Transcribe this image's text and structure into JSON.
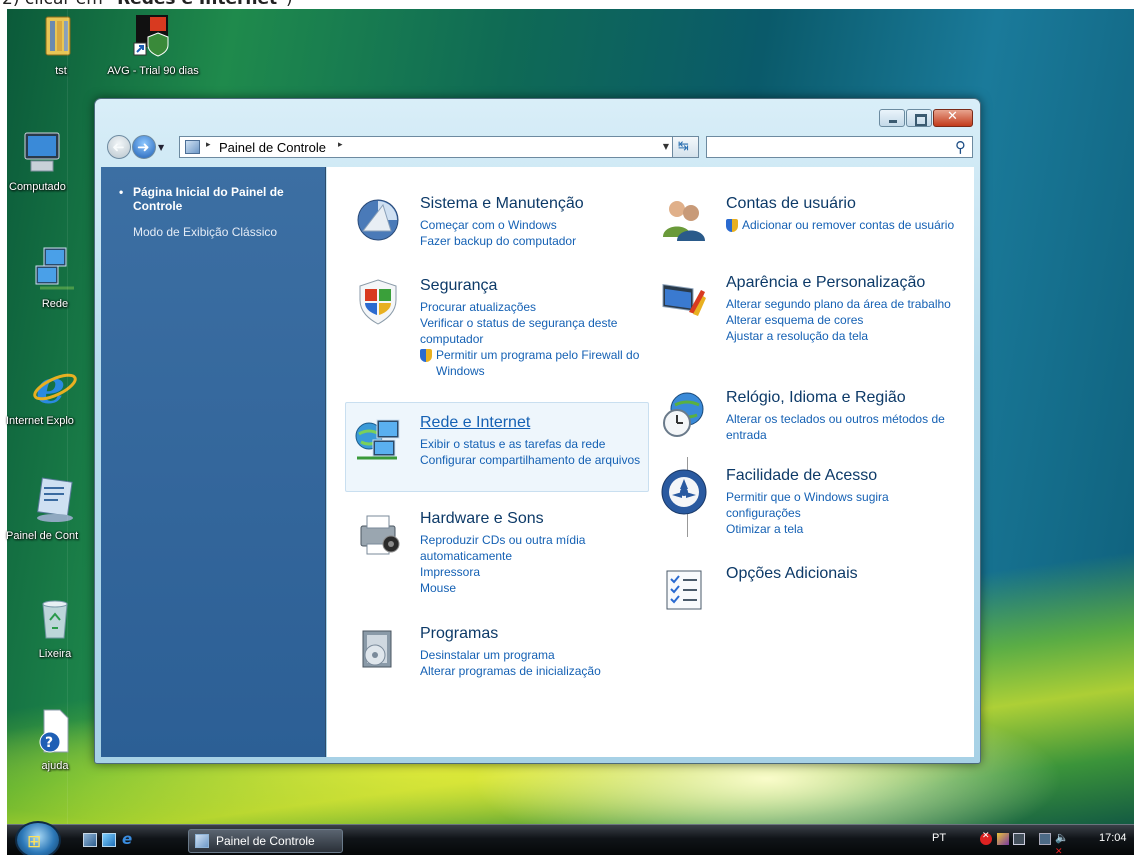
{
  "caption": {
    "prefix": "2) clicar em ",
    "bold": "\"Redes e Internet\"",
    "suffix": ")"
  },
  "desktop": {
    "icons": [
      {
        "label": "tst"
      },
      {
        "label": "AVG - Trial 90 dias"
      },
      {
        "label": "Computado"
      },
      {
        "label": "Rede"
      },
      {
        "label": "Internet Explo"
      },
      {
        "label": "Painel de Cont"
      },
      {
        "label": "Lixeira"
      },
      {
        "label": "ajuda"
      }
    ]
  },
  "window": {
    "address": {
      "crumb": "Painel de Controle",
      "arrow": "▸"
    },
    "search": {
      "placeholder": ""
    },
    "side": {
      "home": "Página Inicial do Painel de Controle",
      "classic": "Modo de Exibição Clássico"
    },
    "categories": {
      "sistema": {
        "title": "Sistema e Manutenção",
        "links": [
          "Começar com o Windows",
          "Fazer backup do computador"
        ],
        "icon": "system-maintenance-icon"
      },
      "seguranca": {
        "title": "Segurança",
        "links": [
          "Procurar atualizações",
          "Verificar o status de segurança deste computador",
          "Permitir um programa pelo Firewall do Windows"
        ],
        "icon": "security-shield-icon"
      },
      "rede": {
        "title": "Rede e Internet",
        "links": [
          "Exibir o status e as tarefas da rede",
          "Configurar compartilhamento de arquivos"
        ],
        "icon": "network-icon"
      },
      "hardware": {
        "title": "Hardware e Sons",
        "links": [
          "Reproduzir CDs ou outra mídia automaticamente",
          "Impressora",
          "Mouse"
        ],
        "icon": "printer-icon"
      },
      "programas": {
        "title": "Programas",
        "links": [
          "Desinstalar um programa",
          "Alterar programas de inicialização"
        ],
        "icon": "programs-icon"
      },
      "contas": {
        "title": "Contas de usuário",
        "links": [
          "Adicionar ou remover contas de usuário"
        ],
        "icon": "users-icon"
      },
      "aparencia": {
        "title": "Aparência e Personalização",
        "links": [
          "Alterar segundo plano da área de trabalho",
          "Alterar esquema de cores",
          "Ajustar a resolução da tela"
        ],
        "icon": "appearance-icon"
      },
      "relogio": {
        "title": "Relógio, Idioma e Região",
        "links": [
          "Alterar os teclados ou outros métodos de entrada"
        ],
        "icon": "clock-globe-icon"
      },
      "facilidade": {
        "title": "Facilidade de Acesso",
        "links": [
          "Permitir que o Windows sugira configurações",
          "Otimizar a tela"
        ],
        "icon": "ease-of-access-icon"
      },
      "opcoes": {
        "title": "Opções Adicionais",
        "links": [],
        "icon": "checklist-icon"
      }
    }
  },
  "taskbar": {
    "task_label": "Painel de Controle",
    "language": "PT",
    "clock": "17:04"
  }
}
